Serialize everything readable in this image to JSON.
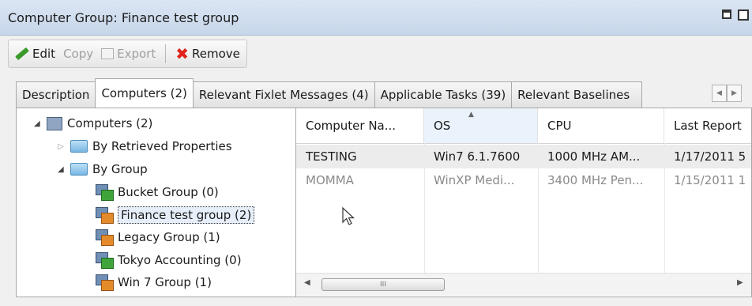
{
  "window": {
    "title": "Computer Group: Finance test group",
    "icons": [
      "dock-icon",
      "maximize-icon"
    ]
  },
  "toolbar": {
    "edit": "Edit",
    "copy": "Copy",
    "export": "Export",
    "remove": "Remove"
  },
  "tabs": [
    {
      "label": "Description",
      "active": false
    },
    {
      "label": "Computers (2)",
      "active": true
    },
    {
      "label": "Relevant Fixlet Messages (4)",
      "active": false
    },
    {
      "label": "Applicable Tasks (39)",
      "active": false
    },
    {
      "label": "Relevant Baselines",
      "active": false
    }
  ],
  "tree": {
    "root": "Computers (2)",
    "retrieved": "By Retrieved Properties",
    "by_group": "By Group",
    "groups": [
      "Bucket Group (0)",
      "Finance test group (2)",
      "Legacy Group (1)",
      "Tokyo Accounting (0)",
      "Win 7 Group (1)"
    ]
  },
  "grid": {
    "columns": [
      "Computer Na...",
      "OS",
      "CPU",
      "Last Report"
    ],
    "rows": [
      [
        "TESTING",
        "Win7 6.1.7600",
        "1000 MHz AM...",
        "1/17/2011 5"
      ],
      [
        "MOMMA",
        "WinXP Medi...",
        "3400 MHz Pen...",
        "1/15/2011 1"
      ]
    ],
    "scroll_grip": "III"
  }
}
